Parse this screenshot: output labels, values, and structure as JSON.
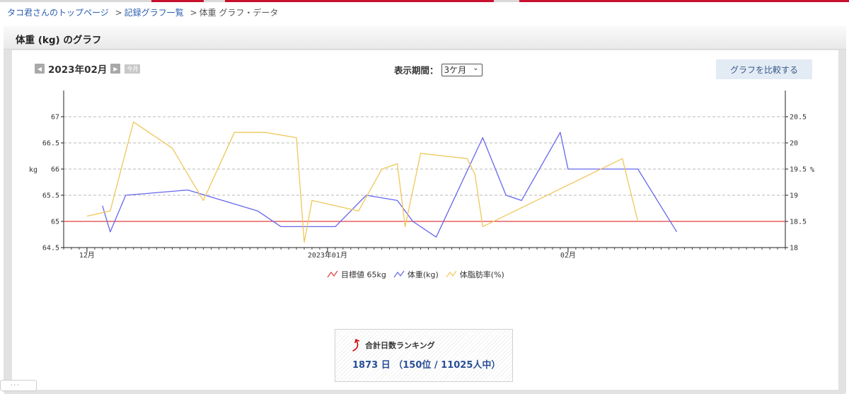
{
  "breadcrumb": {
    "home": "タコ君さんのトップページ",
    "list": "記録グラフ一覧",
    "current": "体重 グラフ・データ",
    "sep": ">"
  },
  "panel": {
    "title": "体重 (kg) のグラフ"
  },
  "month_nav": {
    "prev_icon": "◀",
    "month": "2023年02月",
    "next_icon": "▶",
    "today": "今月"
  },
  "period": {
    "label": "表示期間：",
    "selected": "3ケ月",
    "chevron": "⌄"
  },
  "compare_button": "グラフを比較する",
  "chart_data": {
    "type": "line",
    "xlabel": "",
    "ylabel": "kg",
    "y2label": "%",
    "x_range": [
      "2022-11-28",
      "2023-03-01"
    ],
    "x_ticks": [
      {
        "date": "2022-12-01",
        "label": "12月"
      },
      {
        "date": "2023-01-01",
        "label": "2023年01月"
      },
      {
        "date": "2023-02-01",
        "label": "02月"
      }
    ],
    "ylim": [
      64.5,
      67.5
    ],
    "y_ticks": [
      64.5,
      65,
      65.5,
      66,
      66.5,
      67
    ],
    "y_tick_labels": [
      "64.5",
      "65",
      "65.5",
      "66",
      "66.5",
      "67"
    ],
    "y2lim": [
      18,
      21
    ],
    "y2_ticks": [
      18,
      18.5,
      19,
      19.5,
      20,
      20.5
    ],
    "y2_tick_labels": [
      "18",
      "18.5",
      "19",
      "19.5",
      "20",
      "20.5"
    ],
    "grid": "horizontal dashed",
    "legend_position": "bottom-center",
    "series": [
      {
        "name": "目標値 65kg",
        "axis": "left",
        "color": "#e03c3c",
        "points": [
          [
            "2022-11-28",
            65
          ],
          [
            "2023-03-01",
            65
          ]
        ]
      },
      {
        "name": "体重(kg)",
        "axis": "left",
        "color": "#6666ee",
        "points": [
          [
            "2022-12-03",
            65.3
          ],
          [
            "2022-12-04",
            64.8
          ],
          [
            "2022-12-06",
            65.5
          ],
          [
            "2022-12-14",
            65.6
          ],
          [
            "2022-12-23",
            65.2
          ],
          [
            "2022-12-26",
            64.9
          ],
          [
            "2023-01-02",
            64.9
          ],
          [
            "2023-01-06",
            65.5
          ],
          [
            "2023-01-10",
            65.4
          ],
          [
            "2023-01-12",
            65.0
          ],
          [
            "2023-01-15",
            64.7
          ],
          [
            "2023-01-21",
            66.6
          ],
          [
            "2023-01-24",
            65.5
          ],
          [
            "2023-01-26",
            65.4
          ],
          [
            "2023-01-31",
            66.7
          ],
          [
            "2023-02-01",
            66.0
          ],
          [
            "2023-02-10",
            66.0
          ],
          [
            "2023-02-15",
            64.8
          ]
        ]
      },
      {
        "name": "体脂肪率(%)",
        "axis": "right",
        "color": "#eec75a",
        "points": [
          [
            "2022-12-01",
            18.6
          ],
          [
            "2022-12-04",
            18.7
          ],
          [
            "2022-12-07",
            20.4
          ],
          [
            "2022-12-12",
            19.9
          ],
          [
            "2022-12-16",
            18.9
          ],
          [
            "2022-12-20",
            20.2
          ],
          [
            "2022-12-24",
            20.2
          ],
          [
            "2022-12-28",
            20.1
          ],
          [
            "2022-12-29",
            18.1
          ],
          [
            "2022-12-30",
            18.9
          ],
          [
            "2023-01-05",
            18.7
          ],
          [
            "2023-01-08",
            19.5
          ],
          [
            "2023-01-10",
            19.6
          ],
          [
            "2023-01-11",
            18.4
          ],
          [
            "2023-01-13",
            19.8
          ],
          [
            "2023-01-19",
            19.7
          ],
          [
            "2023-01-20",
            19.4
          ],
          [
            "2023-01-21",
            18.4
          ],
          [
            "2023-02-08",
            19.7
          ],
          [
            "2023-02-10",
            18.5
          ]
        ]
      }
    ]
  },
  "legend": [
    {
      "label": "目標値 65kg",
      "color": "#e03c3c"
    },
    {
      "label": "体重(kg)",
      "color": "#6666ee"
    },
    {
      "label": "体脂肪率(%)",
      "color": "#eec75a"
    }
  ],
  "ranking": {
    "icon": "⤴",
    "title": "合計日数ランキング",
    "value": "1873 日 （150位 / 11025人中）"
  }
}
